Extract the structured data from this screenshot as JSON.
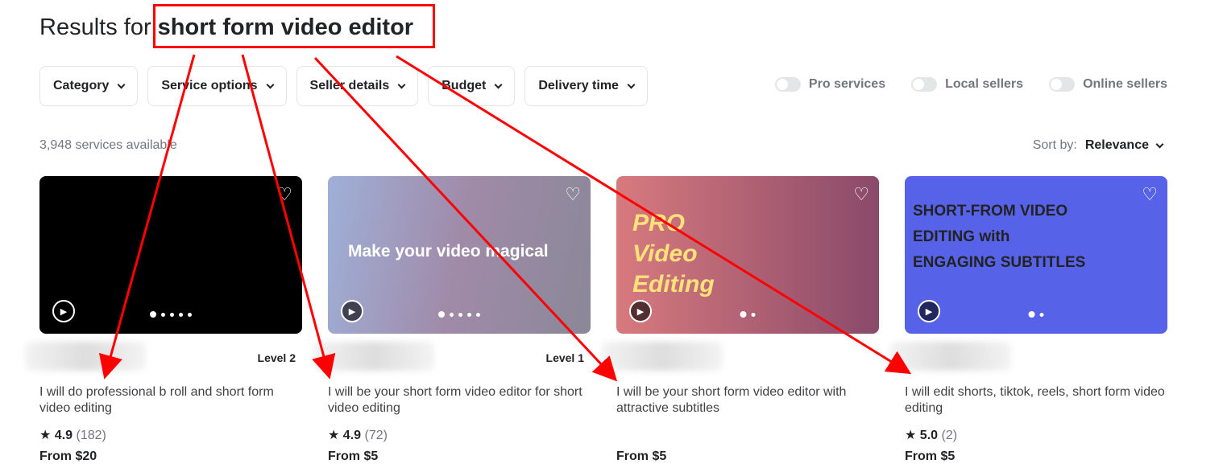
{
  "header": {
    "prefix": "Results for",
    "query": "short form video editor"
  },
  "filters": [
    "Category",
    "Service options",
    "Seller details",
    "Budget",
    "Delivery time"
  ],
  "toggles": [
    "Pro services",
    "Local sellers",
    "Online sellers"
  ],
  "results_count": "3,948 services available",
  "sort": {
    "label": "Sort by:",
    "value": "Relevance"
  },
  "cards": [
    {
      "level": "Level 2",
      "title": "I will do professional b roll and short form video editing",
      "rating": "4.9",
      "reviews": "(182)",
      "price": "From $20",
      "image_text": ""
    },
    {
      "level": "Level 1",
      "title": "I will be your short form video editor for short video editing",
      "rating": "4.9",
      "reviews": "(72)",
      "price": "From $5",
      "image_text": "Make your video magical"
    },
    {
      "level": "",
      "title": "I will be your short form video editor with attractive subtitles",
      "rating": "",
      "reviews": "",
      "price": "From $5",
      "image_text": "PRO Video Editing"
    },
    {
      "level": "",
      "title": "I will edit shorts, tiktok, reels, short form video editing",
      "rating": "5.0",
      "reviews": "(2)",
      "price": "From $5",
      "image_text": "SHORT-FROM VIDEO EDITING with ENGAGING SUBTITLES"
    }
  ],
  "colors": {
    "annotation": "#ff0000",
    "text": "#222325",
    "muted": "#74767e"
  }
}
